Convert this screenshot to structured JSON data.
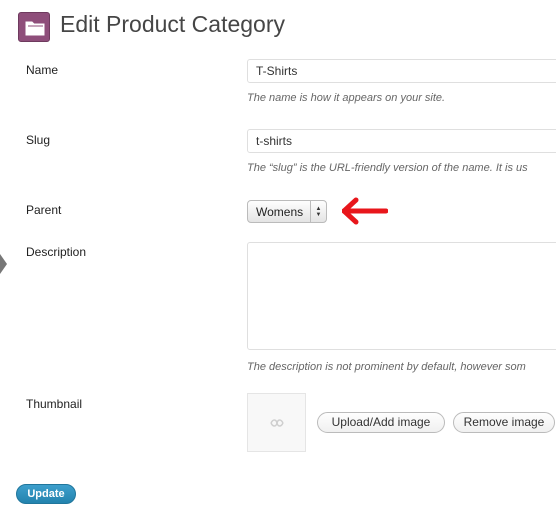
{
  "header": {
    "title": "Edit Product Category"
  },
  "fields": {
    "name": {
      "label": "Name",
      "value": "T-Shirts",
      "description": "The name is how it appears on your site."
    },
    "slug": {
      "label": "Slug",
      "value": "t-shirts",
      "description": "The “slug” is the URL-friendly version of the name. It is us"
    },
    "parent": {
      "label": "Parent",
      "selected": "Womens"
    },
    "description": {
      "label": "Description",
      "value": "",
      "description": "The description is not prominent by default, however som"
    },
    "thumbnail": {
      "label": "Thumbnail",
      "upload_label": "Upload/Add image",
      "remove_label": "Remove image"
    }
  },
  "actions": {
    "update_label": "Update"
  },
  "colors": {
    "header_icon": "#8e4e7a",
    "annotation_arrow": "#e8161b",
    "primary_button": "#2383ae"
  },
  "icons": {
    "header": "folder-icon",
    "thumbnail": "placeholder-image-icon",
    "select": "select-arrows-icon",
    "annotation": "left-arrow-icon"
  }
}
